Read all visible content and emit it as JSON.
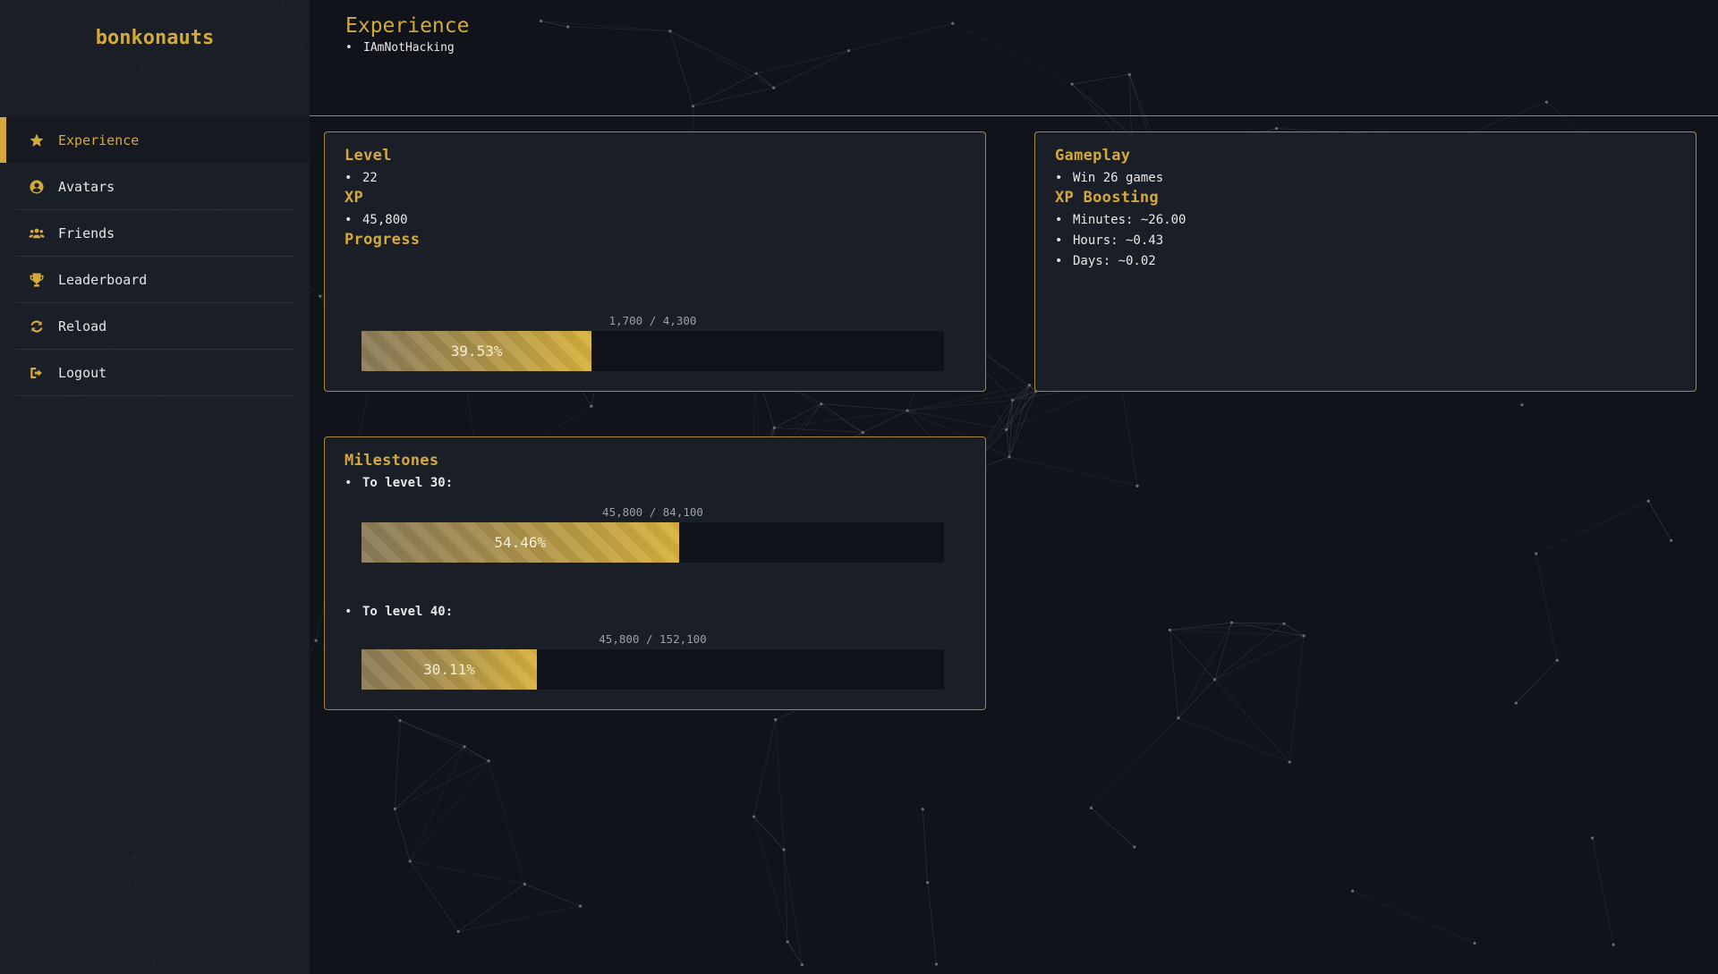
{
  "brand": "bonkonauts",
  "sidebar": {
    "items": [
      {
        "label": "Experience",
        "icon": "star-icon",
        "active": true
      },
      {
        "label": "Avatars",
        "icon": "user-circle-icon",
        "active": false
      },
      {
        "label": "Friends",
        "icon": "users-icon",
        "active": false
      },
      {
        "label": "Leaderboard",
        "icon": "trophy-icon",
        "active": false
      },
      {
        "label": "Reload",
        "icon": "refresh-icon",
        "active": false
      },
      {
        "label": "Logout",
        "icon": "logout-icon",
        "active": false
      }
    ]
  },
  "header": {
    "title": "Experience",
    "username": "IAmNotHacking"
  },
  "stats": {
    "level_heading": "Level",
    "level": "22",
    "xp_heading": "XP",
    "xp": "45,800",
    "progress_heading": "Progress",
    "progress_label": "1,700 / 4,300",
    "progress_percent": "39.53%",
    "progress_fraction": 0.3953
  },
  "gameplay": {
    "heading": "Gameplay",
    "win_text": "Win 26 games",
    "boost_heading": "XP Boosting",
    "minutes": "Minutes: ~26.00",
    "hours": "Hours: ~0.43",
    "days": "Days: ~0.02"
  },
  "milestones": {
    "heading": "Milestones",
    "items": [
      {
        "label": "To level 30:",
        "progress_label": "45,800 / 84,100",
        "percent": "54.46%",
        "fraction": 0.5446
      },
      {
        "label": "To level 40:",
        "progress_label": "45,800 / 152,100",
        "percent": "30.11%",
        "fraction": 0.3011
      }
    ]
  },
  "colors": {
    "accent": "#d4a93c",
    "background": "#10131a",
    "panel": "#1b1f28"
  }
}
